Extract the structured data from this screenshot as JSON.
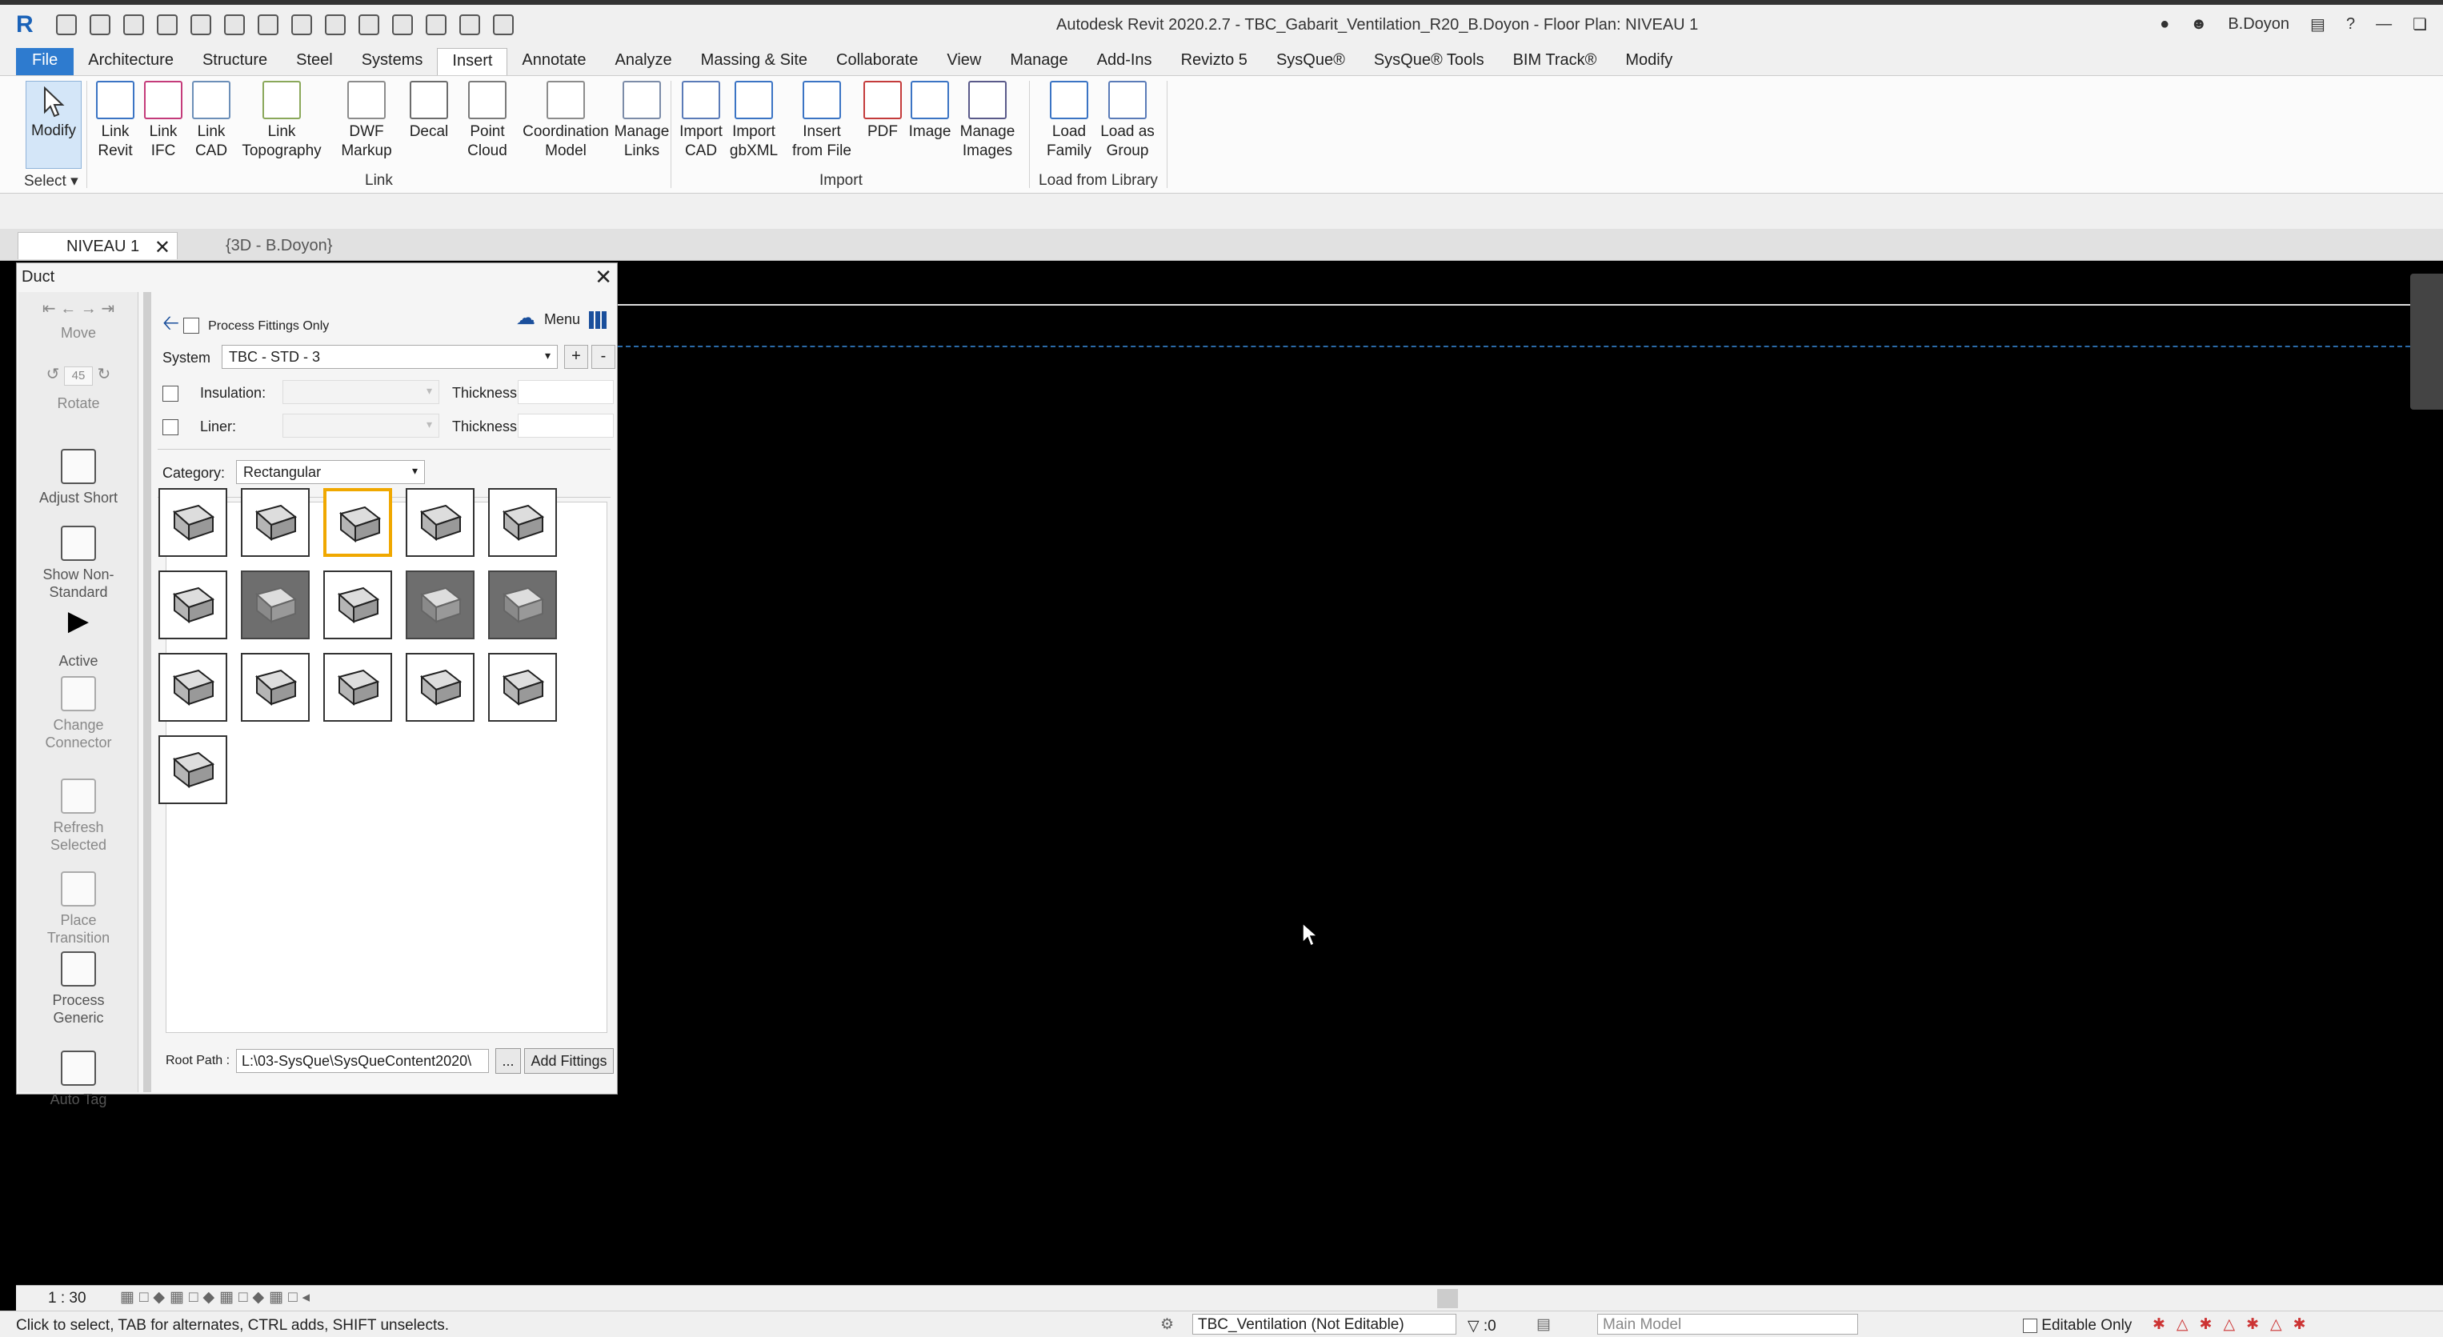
{
  "window": {
    "title": "Autodesk Revit 2020.2.7 - TBC_Gabarit_Ventilation_R20_B.Doyon - Floor Plan: NIVEAU 1",
    "user": "B.Doyon",
    "app_logo": "R"
  },
  "tabs": [
    "File",
    "Architecture",
    "Structure",
    "Steel",
    "Systems",
    "Insert",
    "Annotate",
    "Analyze",
    "Massing & Site",
    "Collaborate",
    "View",
    "Manage",
    "Add-Ins",
    "Revizto 5",
    "SysQue®",
    "SysQue® Tools",
    "BIM Track®",
    "Modify"
  ],
  "active_tab": "Insert",
  "ribbon": {
    "modify": "Modify",
    "select": "Select",
    "link_buttons": [
      [
        "Link",
        "Revit"
      ],
      [
        "Link",
        "IFC"
      ],
      [
        "Link",
        "CAD"
      ],
      [
        "Link",
        "Topography"
      ],
      [
        "DWF",
        "Markup"
      ],
      [
        "Decal",
        ""
      ],
      [
        "Point",
        "Cloud"
      ],
      [
        "Coordination",
        "Model"
      ],
      [
        "Manage",
        "Links"
      ]
    ],
    "link_panel": "Link",
    "import_buttons": [
      [
        "Import",
        "CAD"
      ],
      [
        "Import",
        "gbXML"
      ],
      [
        "Insert",
        "from File"
      ],
      [
        "PDF",
        ""
      ],
      [
        "Image",
        ""
      ],
      [
        "Manage",
        "Images"
      ]
    ],
    "import_panel": "Import",
    "library_buttons": [
      [
        "Load",
        "Family"
      ],
      [
        "Load as",
        "Group"
      ]
    ],
    "library_panel": "Load from Library"
  },
  "view_tabs": {
    "active": "NIVEAU 1",
    "inactive": "{3D - B.Doyon}"
  },
  "palette": {
    "title": "Duct",
    "process_fittings_only": "Process Fittings Only",
    "menu": "Menu",
    "system_label": "System",
    "system_value": "TBC - STD - 3",
    "insulation_label": "Insulation:",
    "liner_label": "Liner:",
    "thickness_label": "Thickness:",
    "category_label": "Category:",
    "category_value": "Rectangular",
    "root_path_label": "Root Path :",
    "root_path_value": "L:\\03-SysQue\\SysQueContent2020\\",
    "browse": "...",
    "add_fittings": "Add Fittings",
    "rotate_angle": "45",
    "tools": [
      {
        "label": "Move"
      },
      {
        "label": "Rotate"
      },
      {
        "label": "Adjust Short"
      },
      {
        "label": "Show Non-Standard"
      },
      {
        "label": "Active"
      },
      {
        "label": "Change Connector"
      },
      {
        "label": "Refresh Selected"
      },
      {
        "label": "Place Transition"
      },
      {
        "label": "Process Generic"
      },
      {
        "label": "Auto Tag"
      }
    ]
  },
  "status": {
    "scale": "1 : 30",
    "hint": "Click to select, TAB for alternates, CTRL adds, SHIFT unselects.",
    "workset": "TBC_Ventilation (Not Editable)",
    "count": ":0",
    "model": "Main Model",
    "editable_only": "Editable Only"
  },
  "colors": {
    "accent": "#2e7bcf",
    "selected_fitting": "#f0a800"
  }
}
